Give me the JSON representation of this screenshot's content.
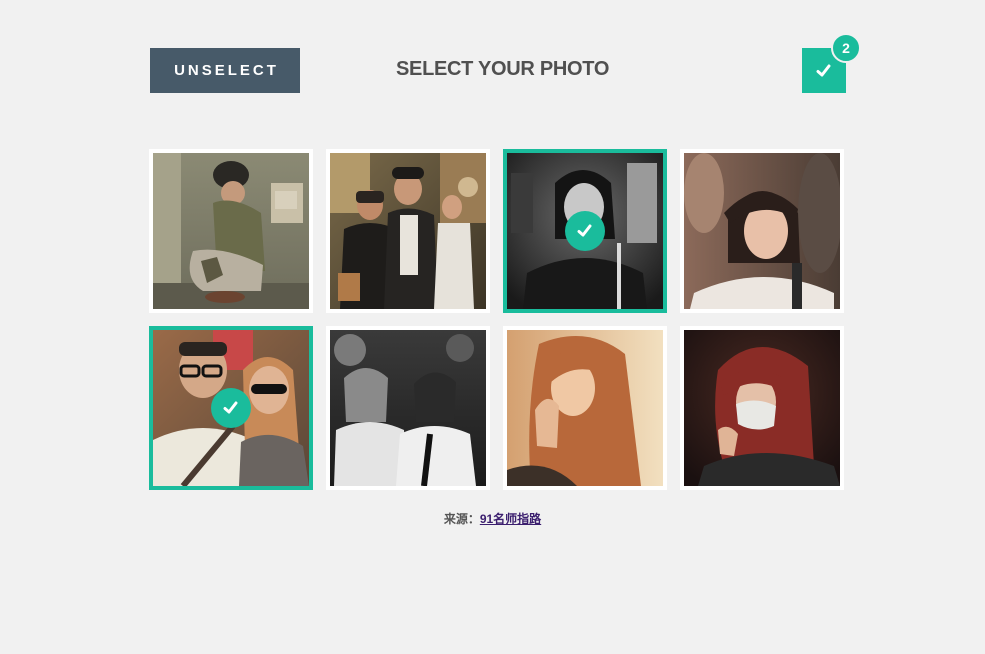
{
  "header": {
    "unselect_label": "UNSELECT",
    "title": "SELECT YOUR PHOTO",
    "selected_count": "2"
  },
  "colors": {
    "accent": "#1abc9c",
    "button_dark": "#475a69",
    "background": "#f1f1f1"
  },
  "photos": [
    {
      "id": "photo-1",
      "selected": false,
      "style": "color"
    },
    {
      "id": "photo-2",
      "selected": false,
      "style": "color"
    },
    {
      "id": "photo-3",
      "selected": true,
      "style": "bw"
    },
    {
      "id": "photo-4",
      "selected": false,
      "style": "color"
    },
    {
      "id": "photo-5",
      "selected": true,
      "style": "color"
    },
    {
      "id": "photo-6",
      "selected": false,
      "style": "bw"
    },
    {
      "id": "photo-7",
      "selected": false,
      "style": "color"
    },
    {
      "id": "photo-8",
      "selected": false,
      "style": "color"
    }
  ],
  "footer": {
    "source_label": "来源：",
    "source_link": "91名师指路"
  },
  "icons": {
    "check": "check-icon"
  }
}
